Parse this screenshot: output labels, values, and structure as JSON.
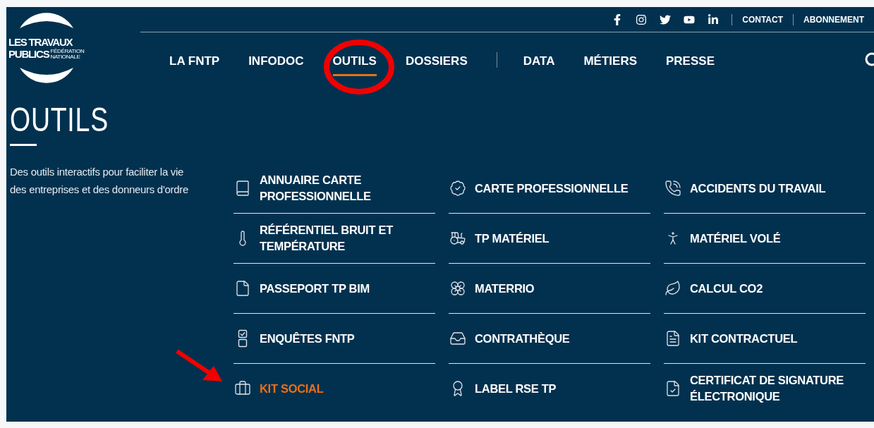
{
  "logo": {
    "line_1": "LES TRAVAUX",
    "line_2": "PUBLICS",
    "tag_1": "FÉDÉRATION",
    "tag_2": "NATIONALE"
  },
  "top_links": [
    {
      "label": "CONTACT"
    },
    {
      "label": "ABONNEMENT"
    }
  ],
  "nav": [
    {
      "label": "LA FNTP",
      "selected": false,
      "circled": false
    },
    {
      "label": "INFODOC",
      "selected": false,
      "circled": false
    },
    {
      "label": "OUTILS",
      "selected": true,
      "circled": true
    },
    {
      "label": "DOSSIERS",
      "selected": false,
      "circled": false
    },
    {
      "label": "DATA",
      "selected": false,
      "circled": false
    },
    {
      "label": "MÉTIERS",
      "selected": false,
      "circled": false
    },
    {
      "label": "PRESSE",
      "selected": false,
      "circled": false
    }
  ],
  "page": {
    "title": "OUTILS",
    "description": "Des outils interactifs pour faciliter la vie des entreprises et des donneurs d'ordre"
  },
  "tools": [
    {
      "label": "ANNUAIRE CARTE PROFESSIONNELLE",
      "selected": false,
      "pointed": false
    },
    {
      "label": "CARTE PROFESSIONNELLE",
      "selected": false,
      "pointed": false
    },
    {
      "label": "ACCIDENTS DU TRAVAIL",
      "selected": false,
      "pointed": false
    },
    {
      "label": "RÉFÉRENTIEL BRUIT ET TEMPÉRATURE",
      "selected": false,
      "pointed": false
    },
    {
      "label": "TP MATÉRIEL",
      "selected": false,
      "pointed": false
    },
    {
      "label": "MATÉRIEL VOLÉ",
      "selected": false,
      "pointed": false
    },
    {
      "label": "PASSEPORT TP BIM",
      "selected": false,
      "pointed": false
    },
    {
      "label": "MATERRIO",
      "selected": false,
      "pointed": false
    },
    {
      "label": "CALCUL CO2",
      "selected": false,
      "pointed": false
    },
    {
      "label": "ENQUÊTES FNTP",
      "selected": false,
      "pointed": false
    },
    {
      "label": "CONTRATHÈQUE",
      "selected": false,
      "pointed": false
    },
    {
      "label": "KIT CONTRACTUEL",
      "selected": false,
      "pointed": false
    },
    {
      "label": "KIT SOCIAL",
      "selected": true,
      "pointed": true
    },
    {
      "label": "LABEL RSE TP",
      "selected": false,
      "pointed": false
    },
    {
      "label": "CERTIFICAT DE SIGNATURE ÉLECTRONIQUE",
      "selected": false,
      "pointed": false
    }
  ]
}
